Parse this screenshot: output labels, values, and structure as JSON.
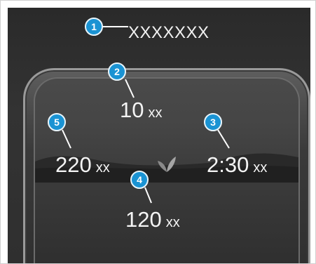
{
  "header": {
    "title": "XXXXXXX"
  },
  "callouts": [
    "1",
    "2",
    "3",
    "4",
    "5"
  ],
  "readouts": {
    "top": {
      "value": "10",
      "unit": "xx"
    },
    "right": {
      "value": "2:30",
      "unit": "xx"
    },
    "bottom": {
      "value": "120",
      "unit": "xx"
    },
    "left": {
      "value": "220",
      "unit": "xx"
    }
  },
  "colors": {
    "callout": "#1a93d3",
    "screen_background": "#2f2f2f",
    "text": "#f4f4f4"
  },
  "icons": {
    "center": "eco-leaf-icon"
  }
}
